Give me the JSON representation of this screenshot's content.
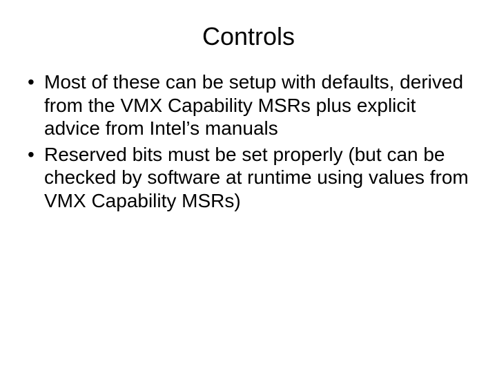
{
  "slide": {
    "title": "Controls",
    "bullets": [
      "Most of these can be setup with defaults, derived from the VMX Capability MSRs plus explicit advice from Intel’s manuals",
      "Reserved bits must be set properly (but can be checked by software at runtime using values from VMX Capability MSRs)"
    ]
  }
}
